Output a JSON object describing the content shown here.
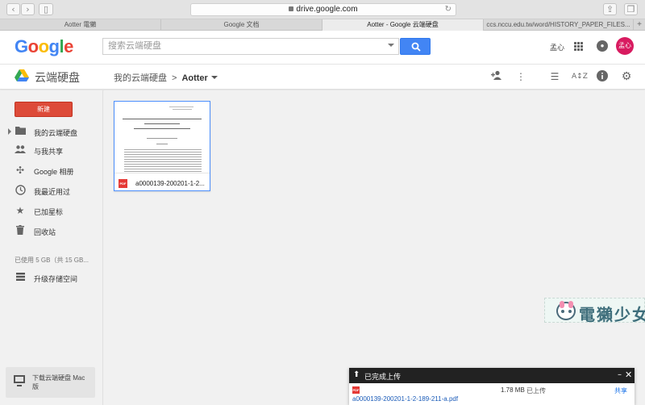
{
  "browser": {
    "url": "drive.google.com",
    "tabs": [
      {
        "label": "Aotter 電獺",
        "active": false
      },
      {
        "label": "Google 文档",
        "active": false
      },
      {
        "label": "Aotter - Google 云端硬盘",
        "active": true
      },
      {
        "label": "ccs.nccu.edu.tw/word/HISTORY_PAPER_FILES...",
        "active": false
      }
    ],
    "new_tab": "+"
  },
  "header": {
    "logo": "Google",
    "search_placeholder": "搜索云端硬盘",
    "user_name": "孟心",
    "avatar_text": "孟心"
  },
  "drive_bar": {
    "title": "云端硬盘",
    "breadcrumb_root": "我的云端硬盘",
    "breadcrumb_separator": ">",
    "breadcrumb_current": "Aotter"
  },
  "sidebar": {
    "new_label": "新建",
    "items": [
      {
        "label": "我的云端硬盘",
        "icon": "folder-icon"
      },
      {
        "label": "与我共享",
        "icon": "people-icon"
      },
      {
        "label": "Google 相册",
        "icon": "pinwheel-icon"
      },
      {
        "label": "我最近用过",
        "icon": "clock-icon"
      },
      {
        "label": "已加星标",
        "icon": "star-icon"
      },
      {
        "label": "回收站",
        "icon": "trash-icon"
      }
    ],
    "storage_text": "已使用 5 GB（共 15 GB...",
    "upgrade_label": "升级存储空间",
    "download_label": "下载云端硬盘 Mac 版"
  },
  "file": {
    "name": "a0000139-200201-1-2...",
    "type_badge": "PDF"
  },
  "watermark": {
    "text": "電獺少女"
  },
  "upload_panel": {
    "title": "已完成上传",
    "file_size": "1.78 MB",
    "status": "已上传",
    "share_label": "共享",
    "file_name": "a0000139-200201-1-2-189-211-a.pdf",
    "type_badge": "PDF"
  },
  "colors": {
    "new_button": "#dd4b39",
    "search_button": "#4285f4",
    "avatar": "#d81b60",
    "selection_border": "#4d90fe"
  }
}
